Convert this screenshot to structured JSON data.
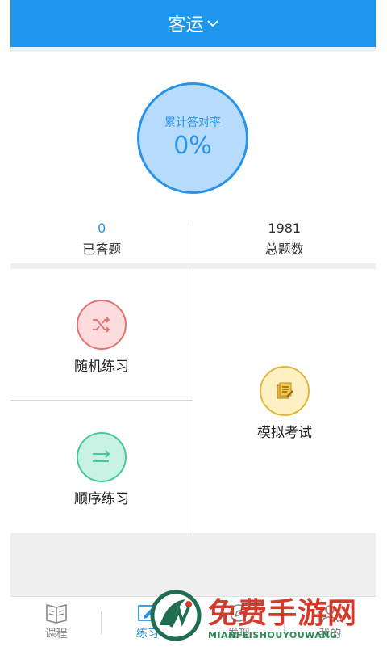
{
  "header": {
    "title": "客运"
  },
  "rate": {
    "label": "累计答对率",
    "value": "0%"
  },
  "stats": [
    {
      "value": "0",
      "label": "已答题"
    },
    {
      "value": "1981",
      "label": "总题数"
    }
  ],
  "modes": {
    "random": "随机练习",
    "order": "顺序练习",
    "exam": "模拟考试"
  },
  "tabs": [
    {
      "label": "课程"
    },
    {
      "label": "练习"
    },
    {
      "label": "发现"
    },
    {
      "label": "我的"
    }
  ],
  "watermark": {
    "title": "免费手游网",
    "subtitle": "MIANFEISHOUYOUWANG"
  },
  "colors": {
    "primary": "#1e96ee",
    "random": "#e57373",
    "order": "#45c99a",
    "exam": "#e3b63a"
  }
}
